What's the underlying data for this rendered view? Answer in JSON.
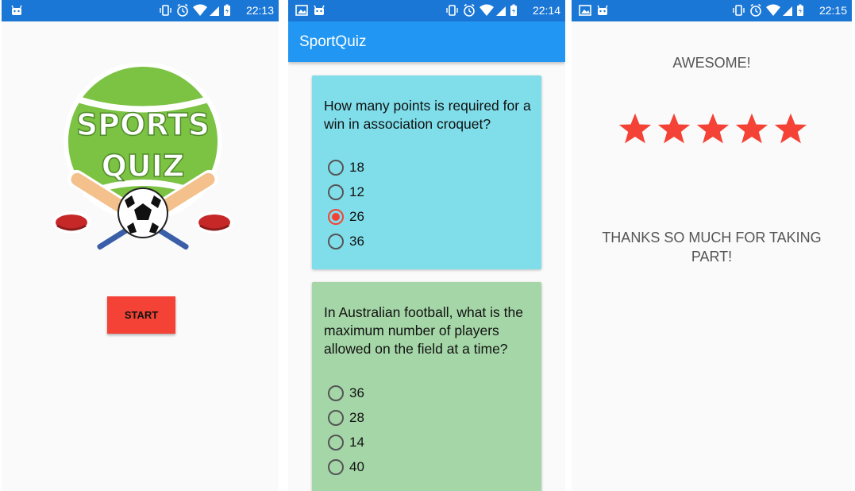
{
  "screens": {
    "home": {
      "status": {
        "time": "22:13"
      },
      "logo": {
        "line1": "SPORTS",
        "line2": "QUIZ"
      },
      "start_label": "START"
    },
    "quiz": {
      "status": {
        "time": "22:14"
      },
      "app_title": "SportQuiz",
      "questions": [
        {
          "text": "How many points is required for a win in association croquet?",
          "options": [
            "18",
            "12",
            "26",
            "36"
          ],
          "selected": "26",
          "card_color": "#80deea"
        },
        {
          "text": "In Australian football, what is the maximum number of players allowed on the field at a time?",
          "options": [
            "36",
            "28",
            "14",
            "40"
          ],
          "card_color": "#a5d6a7"
        }
      ]
    },
    "result": {
      "status": {
        "time": "22:15"
      },
      "heading": "AWESOME!",
      "rating": 5,
      "rating_max": 5,
      "thanks": "THANKS SO MUCH FOR TAKING PART!"
    }
  },
  "colors": {
    "status_bar": "#1b77d6",
    "app_bar": "#2196f3",
    "accent": "#f44336",
    "background": "#fafafa"
  },
  "icons": [
    "android-icon",
    "image-icon",
    "vibrate-icon",
    "alarm-icon",
    "wifi-icon",
    "cell-signal-icon",
    "battery-icon",
    "star-icon",
    "tennis-ball-icon",
    "cricket-bat-icon",
    "soccer-ball-icon"
  ]
}
